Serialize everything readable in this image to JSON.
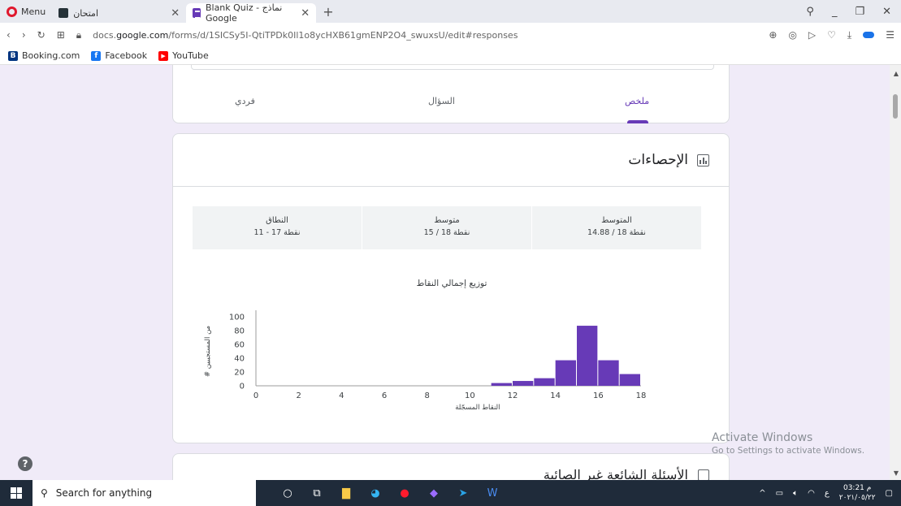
{
  "browser": {
    "menu_label": "Menu",
    "tabs": [
      {
        "title": "امتحان",
        "active": false
      },
      {
        "title": "Blank Quiz - نماذج Google",
        "active": true
      }
    ],
    "new_tab": "+",
    "url_prefix": "docs.",
    "url_domain": "google.com",
    "url_path": "/forms/d/1SICSy5I-QtiTPDk0Il1o8ycHXB61gmENP2O4_swuxsU/edit#responses",
    "bookmarks": [
      {
        "label": "Booking.com",
        "icon": "B",
        "color": "#003580"
      },
      {
        "label": "Facebook",
        "icon": "f",
        "color": "#1877f2"
      },
      {
        "label": "YouTube",
        "icon": "▶",
        "color": "#ff0000"
      }
    ]
  },
  "responses_tabs": {
    "summary": "ملخص",
    "question": "السؤال",
    "individual": "فردي"
  },
  "stats": {
    "title": "الإحصاءات",
    "boxes": [
      {
        "label": "المتوسط",
        "value": "14.88 / 18 نقطة"
      },
      {
        "label": "متوسط",
        "value": "15 / 18 نقطة"
      },
      {
        "label": "النطاق",
        "value": "11 - 17 نقطة"
      }
    ]
  },
  "chart_data": {
    "type": "bar",
    "title": "توزيع إجمالي النقاط",
    "xlabel": "النقاط المسجّلة",
    "ylabel": "# من المستجيبين",
    "x": [
      11,
      12,
      13,
      14,
      15,
      16,
      17
    ],
    "values": [
      4,
      7,
      11,
      37,
      87,
      37,
      17
    ],
    "xlim": [
      0,
      18
    ],
    "ylim": [
      0,
      100
    ],
    "xticks": [
      0,
      2,
      4,
      6,
      8,
      10,
      12,
      14,
      16,
      18
    ],
    "yticks": [
      0,
      20,
      40,
      60,
      80,
      100
    ],
    "bar_color": "#673ab7",
    "grid": false
  },
  "next_section": {
    "title": "الأسئلة الشائعة غير الصائبة"
  },
  "watermark": {
    "line1": "Activate Windows",
    "line2": "Go to Settings to activate Windows."
  },
  "taskbar": {
    "search_placeholder": "Search for anything",
    "time": "03:21 م",
    "date": "٢٠٢١/٠٥/٢٢",
    "lang": "ع"
  }
}
